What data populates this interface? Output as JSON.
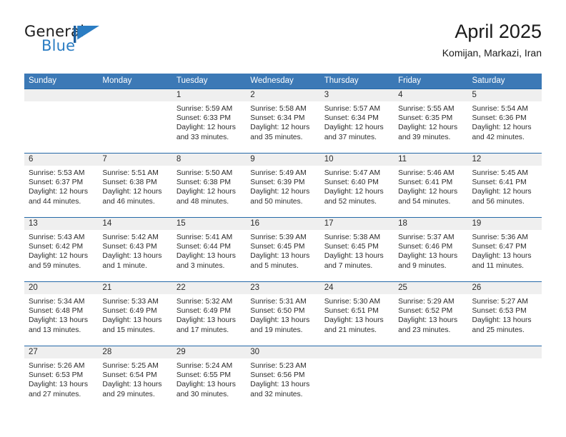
{
  "brand": {
    "name_part1": "General",
    "name_part2": "Blue",
    "mark": "triangle-flag-icon",
    "accent_color": "#2b7dc3"
  },
  "header": {
    "title": "April 2025",
    "subtitle": "Komijan, Markazi, Iran"
  },
  "theme": {
    "header_blue": "#3c79b6",
    "rule_blue": "#2569a8",
    "numbers_band": "#efefef",
    "text": "#2b2b2b"
  },
  "calendar": {
    "day_headers": [
      "Sunday",
      "Monday",
      "Tuesday",
      "Wednesday",
      "Thursday",
      "Friday",
      "Saturday"
    ],
    "weeks": [
      {
        "days": [
          {
            "number": "",
            "sunrise": "",
            "sunset": "",
            "daylight_line1": "",
            "daylight_line2": "",
            "empty": true
          },
          {
            "number": "",
            "sunrise": "",
            "sunset": "",
            "daylight_line1": "",
            "daylight_line2": "",
            "empty": true
          },
          {
            "number": "1",
            "sunrise": "Sunrise: 5:59 AM",
            "sunset": "Sunset: 6:33 PM",
            "daylight_line1": "Daylight: 12 hours",
            "daylight_line2": "and 33 minutes.",
            "empty": false
          },
          {
            "number": "2",
            "sunrise": "Sunrise: 5:58 AM",
            "sunset": "Sunset: 6:34 PM",
            "daylight_line1": "Daylight: 12 hours",
            "daylight_line2": "and 35 minutes.",
            "empty": false
          },
          {
            "number": "3",
            "sunrise": "Sunrise: 5:57 AM",
            "sunset": "Sunset: 6:34 PM",
            "daylight_line1": "Daylight: 12 hours",
            "daylight_line2": "and 37 minutes.",
            "empty": false
          },
          {
            "number": "4",
            "sunrise": "Sunrise: 5:55 AM",
            "sunset": "Sunset: 6:35 PM",
            "daylight_line1": "Daylight: 12 hours",
            "daylight_line2": "and 39 minutes.",
            "empty": false
          },
          {
            "number": "5",
            "sunrise": "Sunrise: 5:54 AM",
            "sunset": "Sunset: 6:36 PM",
            "daylight_line1": "Daylight: 12 hours",
            "daylight_line2": "and 42 minutes.",
            "empty": false
          }
        ]
      },
      {
        "days": [
          {
            "number": "6",
            "sunrise": "Sunrise: 5:53 AM",
            "sunset": "Sunset: 6:37 PM",
            "daylight_line1": "Daylight: 12 hours",
            "daylight_line2": "and 44 minutes.",
            "empty": false
          },
          {
            "number": "7",
            "sunrise": "Sunrise: 5:51 AM",
            "sunset": "Sunset: 6:38 PM",
            "daylight_line1": "Daylight: 12 hours",
            "daylight_line2": "and 46 minutes.",
            "empty": false
          },
          {
            "number": "8",
            "sunrise": "Sunrise: 5:50 AM",
            "sunset": "Sunset: 6:38 PM",
            "daylight_line1": "Daylight: 12 hours",
            "daylight_line2": "and 48 minutes.",
            "empty": false
          },
          {
            "number": "9",
            "sunrise": "Sunrise: 5:49 AM",
            "sunset": "Sunset: 6:39 PM",
            "daylight_line1": "Daylight: 12 hours",
            "daylight_line2": "and 50 minutes.",
            "empty": false
          },
          {
            "number": "10",
            "sunrise": "Sunrise: 5:47 AM",
            "sunset": "Sunset: 6:40 PM",
            "daylight_line1": "Daylight: 12 hours",
            "daylight_line2": "and 52 minutes.",
            "empty": false
          },
          {
            "number": "11",
            "sunrise": "Sunrise: 5:46 AM",
            "sunset": "Sunset: 6:41 PM",
            "daylight_line1": "Daylight: 12 hours",
            "daylight_line2": "and 54 minutes.",
            "empty": false
          },
          {
            "number": "12",
            "sunrise": "Sunrise: 5:45 AM",
            "sunset": "Sunset: 6:41 PM",
            "daylight_line1": "Daylight: 12 hours",
            "daylight_line2": "and 56 minutes.",
            "empty": false
          }
        ]
      },
      {
        "days": [
          {
            "number": "13",
            "sunrise": "Sunrise: 5:43 AM",
            "sunset": "Sunset: 6:42 PM",
            "daylight_line1": "Daylight: 12 hours",
            "daylight_line2": "and 59 minutes.",
            "empty": false
          },
          {
            "number": "14",
            "sunrise": "Sunrise: 5:42 AM",
            "sunset": "Sunset: 6:43 PM",
            "daylight_line1": "Daylight: 13 hours",
            "daylight_line2": "and 1 minute.",
            "empty": false
          },
          {
            "number": "15",
            "sunrise": "Sunrise: 5:41 AM",
            "sunset": "Sunset: 6:44 PM",
            "daylight_line1": "Daylight: 13 hours",
            "daylight_line2": "and 3 minutes.",
            "empty": false
          },
          {
            "number": "16",
            "sunrise": "Sunrise: 5:39 AM",
            "sunset": "Sunset: 6:45 PM",
            "daylight_line1": "Daylight: 13 hours",
            "daylight_line2": "and 5 minutes.",
            "empty": false
          },
          {
            "number": "17",
            "sunrise": "Sunrise: 5:38 AM",
            "sunset": "Sunset: 6:45 PM",
            "daylight_line1": "Daylight: 13 hours",
            "daylight_line2": "and 7 minutes.",
            "empty": false
          },
          {
            "number": "18",
            "sunrise": "Sunrise: 5:37 AM",
            "sunset": "Sunset: 6:46 PM",
            "daylight_line1": "Daylight: 13 hours",
            "daylight_line2": "and 9 minutes.",
            "empty": false
          },
          {
            "number": "19",
            "sunrise": "Sunrise: 5:36 AM",
            "sunset": "Sunset: 6:47 PM",
            "daylight_line1": "Daylight: 13 hours",
            "daylight_line2": "and 11 minutes.",
            "empty": false
          }
        ]
      },
      {
        "days": [
          {
            "number": "20",
            "sunrise": "Sunrise: 5:34 AM",
            "sunset": "Sunset: 6:48 PM",
            "daylight_line1": "Daylight: 13 hours",
            "daylight_line2": "and 13 minutes.",
            "empty": false
          },
          {
            "number": "21",
            "sunrise": "Sunrise: 5:33 AM",
            "sunset": "Sunset: 6:49 PM",
            "daylight_line1": "Daylight: 13 hours",
            "daylight_line2": "and 15 minutes.",
            "empty": false
          },
          {
            "number": "22",
            "sunrise": "Sunrise: 5:32 AM",
            "sunset": "Sunset: 6:49 PM",
            "daylight_line1": "Daylight: 13 hours",
            "daylight_line2": "and 17 minutes.",
            "empty": false
          },
          {
            "number": "23",
            "sunrise": "Sunrise: 5:31 AM",
            "sunset": "Sunset: 6:50 PM",
            "daylight_line1": "Daylight: 13 hours",
            "daylight_line2": "and 19 minutes.",
            "empty": false
          },
          {
            "number": "24",
            "sunrise": "Sunrise: 5:30 AM",
            "sunset": "Sunset: 6:51 PM",
            "daylight_line1": "Daylight: 13 hours",
            "daylight_line2": "and 21 minutes.",
            "empty": false
          },
          {
            "number": "25",
            "sunrise": "Sunrise: 5:29 AM",
            "sunset": "Sunset: 6:52 PM",
            "daylight_line1": "Daylight: 13 hours",
            "daylight_line2": "and 23 minutes.",
            "empty": false
          },
          {
            "number": "26",
            "sunrise": "Sunrise: 5:27 AM",
            "sunset": "Sunset: 6:53 PM",
            "daylight_line1": "Daylight: 13 hours",
            "daylight_line2": "and 25 minutes.",
            "empty": false
          }
        ]
      },
      {
        "days": [
          {
            "number": "27",
            "sunrise": "Sunrise: 5:26 AM",
            "sunset": "Sunset: 6:53 PM",
            "daylight_line1": "Daylight: 13 hours",
            "daylight_line2": "and 27 minutes.",
            "empty": false
          },
          {
            "number": "28",
            "sunrise": "Sunrise: 5:25 AM",
            "sunset": "Sunset: 6:54 PM",
            "daylight_line1": "Daylight: 13 hours",
            "daylight_line2": "and 29 minutes.",
            "empty": false
          },
          {
            "number": "29",
            "sunrise": "Sunrise: 5:24 AM",
            "sunset": "Sunset: 6:55 PM",
            "daylight_line1": "Daylight: 13 hours",
            "daylight_line2": "and 30 minutes.",
            "empty": false
          },
          {
            "number": "30",
            "sunrise": "Sunrise: 5:23 AM",
            "sunset": "Sunset: 6:56 PM",
            "daylight_line1": "Daylight: 13 hours",
            "daylight_line2": "and 32 minutes.",
            "empty": false
          },
          {
            "number": "",
            "sunrise": "",
            "sunset": "",
            "daylight_line1": "",
            "daylight_line2": "",
            "empty": true
          },
          {
            "number": "",
            "sunrise": "",
            "sunset": "",
            "daylight_line1": "",
            "daylight_line2": "",
            "empty": true
          },
          {
            "number": "",
            "sunrise": "",
            "sunset": "",
            "daylight_line1": "",
            "daylight_line2": "",
            "empty": true
          }
        ]
      }
    ]
  }
}
